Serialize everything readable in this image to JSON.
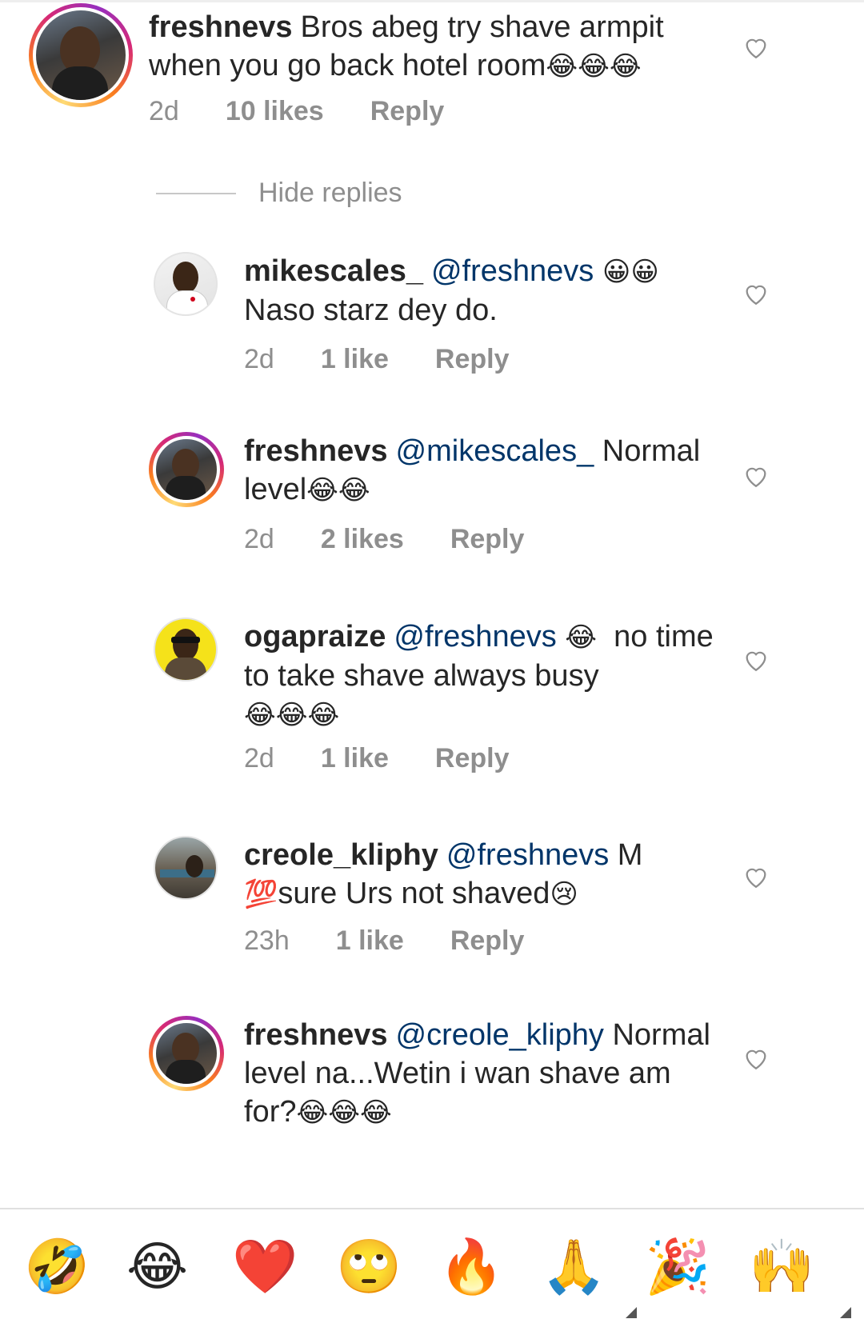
{
  "comments": [
    {
      "username": "freshnevs",
      "mention": "",
      "text": "Bros abeg try shave armpit when you go back hotel room",
      "emoji": "😂😂😂",
      "time": "2d",
      "likes": "10 likes",
      "reply": "Reply"
    },
    {
      "username": "mikescales_",
      "mention": "@freshnevs",
      "text_pre": "😀😀",
      "text": "Naso starz dey do.",
      "emoji": "",
      "time": "2d",
      "likes": "1 like",
      "reply": "Reply"
    },
    {
      "username": "freshnevs",
      "mention": "@mikescales_",
      "text": "Normal level",
      "emoji": "😂😂",
      "time": "2d",
      "likes": "2 likes",
      "reply": "Reply"
    },
    {
      "username": "ogapraize",
      "mention": "@freshnevs",
      "text_pre": "😂",
      "text": "no time to take shave always busy",
      "emoji": "😂😂😂",
      "time": "2d",
      "likes": "1 like",
      "reply": "Reply"
    },
    {
      "username": "creole_kliphy",
      "mention": "@freshnevs",
      "text": "M",
      "text_pre": "💯",
      "text2": "sure Urs not shaved",
      "emoji": "😢",
      "time": "23h",
      "likes": "1 like",
      "reply": "Reply"
    },
    {
      "username": "freshnevs",
      "mention": "@creole_kliphy",
      "text": "Normal level na...Wetin i wan shave am for?",
      "emoji": "😂😂😂",
      "time": "",
      "likes": "",
      "reply": ""
    }
  ],
  "hide_replies": "Hide replies",
  "quick_reactions": [
    "🤣",
    "😂",
    "❤️",
    "🙄",
    "🔥",
    "🙏",
    "🎉",
    "🙌"
  ],
  "colors": {
    "mention": "#003569",
    "meta": "#8e8e8e",
    "text": "#262626"
  }
}
